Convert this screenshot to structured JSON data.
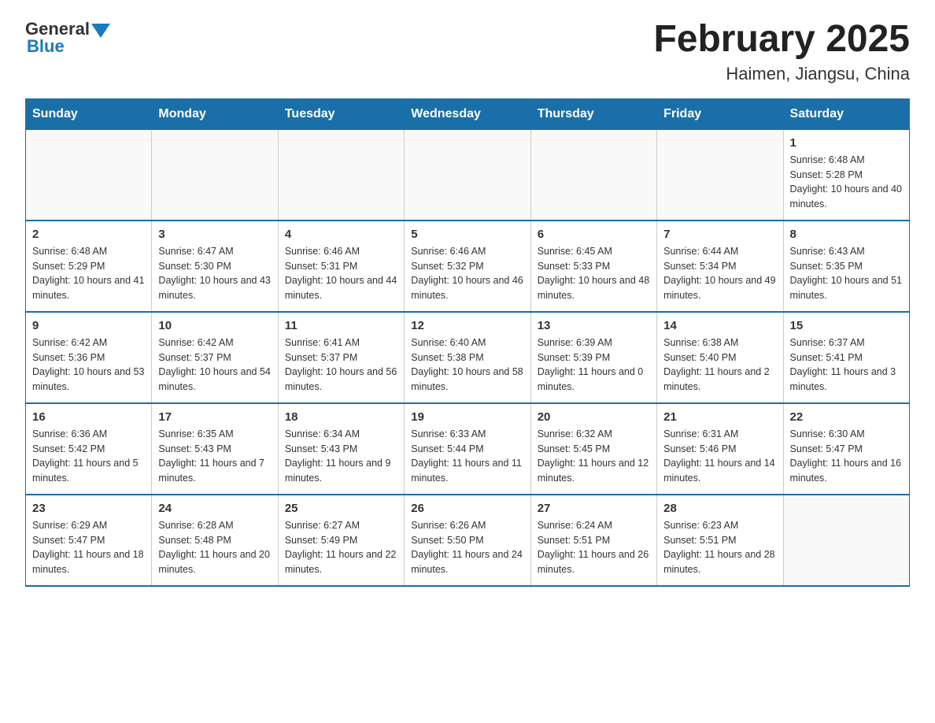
{
  "header": {
    "logo_general": "General",
    "logo_blue": "Blue",
    "title": "February 2025",
    "subtitle": "Haimen, Jiangsu, China"
  },
  "days_of_week": [
    "Sunday",
    "Monday",
    "Tuesday",
    "Wednesday",
    "Thursday",
    "Friday",
    "Saturday"
  ],
  "weeks": [
    [
      {
        "day": "",
        "info": ""
      },
      {
        "day": "",
        "info": ""
      },
      {
        "day": "",
        "info": ""
      },
      {
        "day": "",
        "info": ""
      },
      {
        "day": "",
        "info": ""
      },
      {
        "day": "",
        "info": ""
      },
      {
        "day": "1",
        "info": "Sunrise: 6:48 AM\nSunset: 5:28 PM\nDaylight: 10 hours and 40 minutes."
      }
    ],
    [
      {
        "day": "2",
        "info": "Sunrise: 6:48 AM\nSunset: 5:29 PM\nDaylight: 10 hours and 41 minutes."
      },
      {
        "day": "3",
        "info": "Sunrise: 6:47 AM\nSunset: 5:30 PM\nDaylight: 10 hours and 43 minutes."
      },
      {
        "day": "4",
        "info": "Sunrise: 6:46 AM\nSunset: 5:31 PM\nDaylight: 10 hours and 44 minutes."
      },
      {
        "day": "5",
        "info": "Sunrise: 6:46 AM\nSunset: 5:32 PM\nDaylight: 10 hours and 46 minutes."
      },
      {
        "day": "6",
        "info": "Sunrise: 6:45 AM\nSunset: 5:33 PM\nDaylight: 10 hours and 48 minutes."
      },
      {
        "day": "7",
        "info": "Sunrise: 6:44 AM\nSunset: 5:34 PM\nDaylight: 10 hours and 49 minutes."
      },
      {
        "day": "8",
        "info": "Sunrise: 6:43 AM\nSunset: 5:35 PM\nDaylight: 10 hours and 51 minutes."
      }
    ],
    [
      {
        "day": "9",
        "info": "Sunrise: 6:42 AM\nSunset: 5:36 PM\nDaylight: 10 hours and 53 minutes."
      },
      {
        "day": "10",
        "info": "Sunrise: 6:42 AM\nSunset: 5:37 PM\nDaylight: 10 hours and 54 minutes."
      },
      {
        "day": "11",
        "info": "Sunrise: 6:41 AM\nSunset: 5:37 PM\nDaylight: 10 hours and 56 minutes."
      },
      {
        "day": "12",
        "info": "Sunrise: 6:40 AM\nSunset: 5:38 PM\nDaylight: 10 hours and 58 minutes."
      },
      {
        "day": "13",
        "info": "Sunrise: 6:39 AM\nSunset: 5:39 PM\nDaylight: 11 hours and 0 minutes."
      },
      {
        "day": "14",
        "info": "Sunrise: 6:38 AM\nSunset: 5:40 PM\nDaylight: 11 hours and 2 minutes."
      },
      {
        "day": "15",
        "info": "Sunrise: 6:37 AM\nSunset: 5:41 PM\nDaylight: 11 hours and 3 minutes."
      }
    ],
    [
      {
        "day": "16",
        "info": "Sunrise: 6:36 AM\nSunset: 5:42 PM\nDaylight: 11 hours and 5 minutes."
      },
      {
        "day": "17",
        "info": "Sunrise: 6:35 AM\nSunset: 5:43 PM\nDaylight: 11 hours and 7 minutes."
      },
      {
        "day": "18",
        "info": "Sunrise: 6:34 AM\nSunset: 5:43 PM\nDaylight: 11 hours and 9 minutes."
      },
      {
        "day": "19",
        "info": "Sunrise: 6:33 AM\nSunset: 5:44 PM\nDaylight: 11 hours and 11 minutes."
      },
      {
        "day": "20",
        "info": "Sunrise: 6:32 AM\nSunset: 5:45 PM\nDaylight: 11 hours and 12 minutes."
      },
      {
        "day": "21",
        "info": "Sunrise: 6:31 AM\nSunset: 5:46 PM\nDaylight: 11 hours and 14 minutes."
      },
      {
        "day": "22",
        "info": "Sunrise: 6:30 AM\nSunset: 5:47 PM\nDaylight: 11 hours and 16 minutes."
      }
    ],
    [
      {
        "day": "23",
        "info": "Sunrise: 6:29 AM\nSunset: 5:47 PM\nDaylight: 11 hours and 18 minutes."
      },
      {
        "day": "24",
        "info": "Sunrise: 6:28 AM\nSunset: 5:48 PM\nDaylight: 11 hours and 20 minutes."
      },
      {
        "day": "25",
        "info": "Sunrise: 6:27 AM\nSunset: 5:49 PM\nDaylight: 11 hours and 22 minutes."
      },
      {
        "day": "26",
        "info": "Sunrise: 6:26 AM\nSunset: 5:50 PM\nDaylight: 11 hours and 24 minutes."
      },
      {
        "day": "27",
        "info": "Sunrise: 6:24 AM\nSunset: 5:51 PM\nDaylight: 11 hours and 26 minutes."
      },
      {
        "day": "28",
        "info": "Sunrise: 6:23 AM\nSunset: 5:51 PM\nDaylight: 11 hours and 28 minutes."
      },
      {
        "day": "",
        "info": ""
      }
    ]
  ]
}
